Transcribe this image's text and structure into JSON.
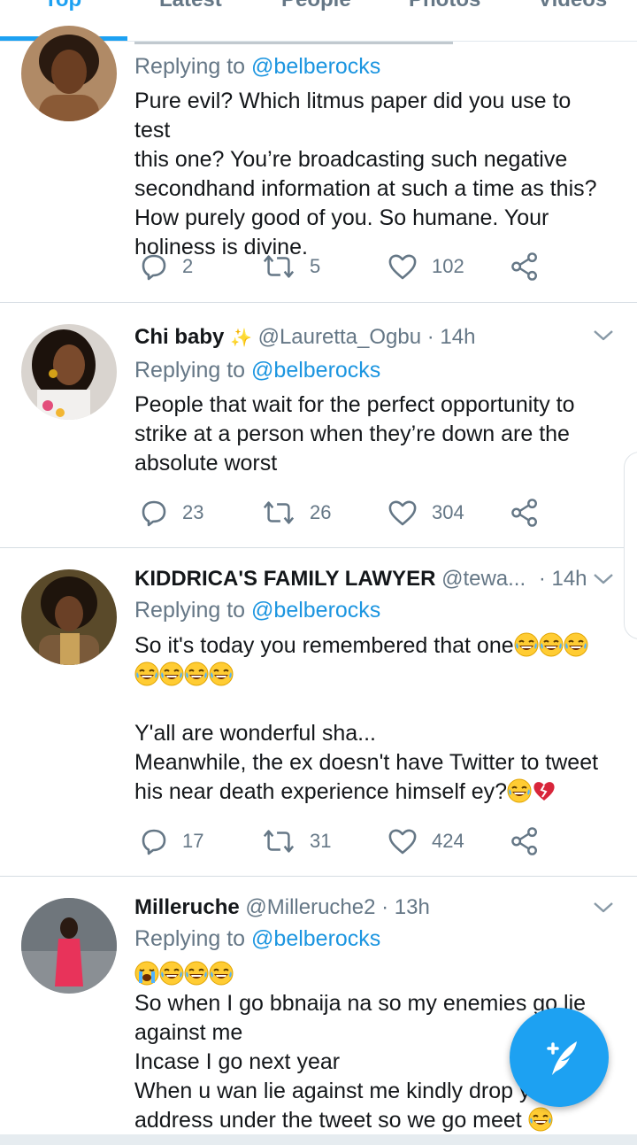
{
  "tabs": [
    {
      "label": "Top",
      "active": true
    },
    {
      "label": "Latest"
    },
    {
      "label": "People"
    },
    {
      "label": "Photos"
    },
    {
      "label": "Videos"
    }
  ],
  "reply_prefix": "Replying to",
  "tweets": [
    {
      "reply_to": "@belberocks",
      "text": [
        "Pure evil? Which litmus paper did you use to test",
        "this one? You’re broadcasting such negative",
        "secondhand information at such a time as this?",
        "How purely good of you. So humane. Your",
        "holiness is divine."
      ],
      "replies": "2",
      "retweets": "5",
      "likes": "102"
    },
    {
      "name": "Chi baby",
      "sparkle": "✨",
      "handle": "@Lauretta_Ogbu",
      "time": "· 14h",
      "reply_to": "@belberocks",
      "text": [
        "People that wait for the perfect opportunity to",
        "strike at a person when they’re down are the",
        "absolute worst"
      ],
      "replies": "23",
      "retweets": "26",
      "likes": "304"
    },
    {
      "name": "KIDDRICA'S FAMILY LAWYER",
      "handle": "@tewa...",
      "time": "· 14h",
      "reply_to": "@belberocks",
      "line1": "So it's today you remembered that one",
      "line3": "Y'all are wonderful sha...",
      "line4": "Meanwhile, the ex doesn't have Twitter to tweet",
      "line5": "his near death experience himself ey?",
      "replies": "17",
      "retweets": "31",
      "likes": "424"
    },
    {
      "name": "Milleruche",
      "handle": "@Milleruche2",
      "time": "· 13h",
      "reply_to": "@belberocks",
      "line2": "So when I go bbnaija na so my enemies go lie",
      "line3": "against me",
      "line4": "Incase I go next year",
      "line5": "When u wan lie against me kindly drop your",
      "line6": "address under the tweet so we go meet"
    }
  ],
  "colors": {
    "accent": "#1da1f2",
    "muted": "#657786",
    "text": "#14171a"
  }
}
